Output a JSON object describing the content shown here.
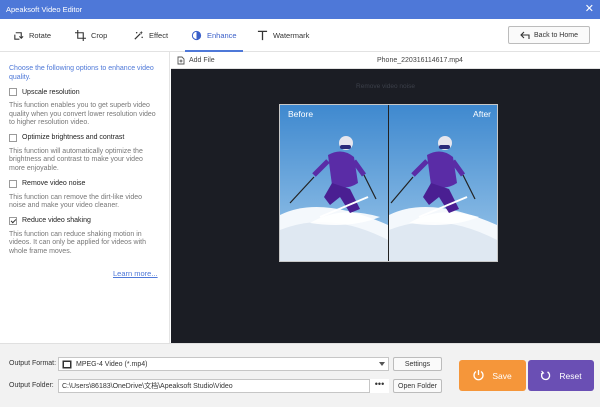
{
  "window": {
    "title": "Apeaksoft Video Editor",
    "close_glyph": "✕"
  },
  "tabs": [
    {
      "label": "Rotate",
      "icon": "rotate-icon"
    },
    {
      "label": "Crop",
      "icon": "crop-icon"
    },
    {
      "label": "Effect",
      "icon": "effect-icon"
    },
    {
      "label": "Enhance",
      "icon": "enhance-icon",
      "active": true
    },
    {
      "label": "Watermark",
      "icon": "watermark-icon"
    }
  ],
  "back_button": {
    "label": "Back to Home",
    "icon": "back-icon"
  },
  "enhance_panel": {
    "intro": "Choose the following options to enhance video quality.",
    "options": [
      {
        "label": "Upscale resolution",
        "checked": false,
        "description": "This function enables you to get superb video quality when you convert lower resolution video to higher resolution video."
      },
      {
        "label": "Optimize brightness and contrast",
        "checked": false,
        "description": "This function will automatically optimize the brightness and contrast to make your video more enjoyable."
      },
      {
        "label": "Remove video noise",
        "checked": false,
        "description": "This function can remove the dirt-like video noise and make your video cleaner."
      },
      {
        "label": "Reduce video shaking",
        "checked": true,
        "description": "This function can reduce shaking motion in videos. It can only be applied for videos with whole frame moves."
      }
    ],
    "learn_more": "Learn more..."
  },
  "preview": {
    "add_file": "Add File",
    "file_name": "Phone_220316114617.mp4",
    "hint": "Remove video noise",
    "before_label": "Before",
    "after_label": "After"
  },
  "output": {
    "format_label": "Output Format:",
    "format_value": "MPEG-4 Video (*.mp4)",
    "format_icon": "mp4-format-icon",
    "settings_label": "Settings",
    "folder_label": "Output Folder:",
    "folder_value": "C:\\Users\\86183\\OneDrive\\文档\\Apeaksoft Studio\\Video",
    "browse_label": "•••",
    "open_folder_label": "Open Folder"
  },
  "actions": {
    "save_label": "Save",
    "reset_label": "Reset"
  },
  "colors": {
    "accent": "#4e78d8",
    "save": "#f5963a",
    "reset": "#6a4fb4",
    "preview_bg": "#1b1d24"
  }
}
